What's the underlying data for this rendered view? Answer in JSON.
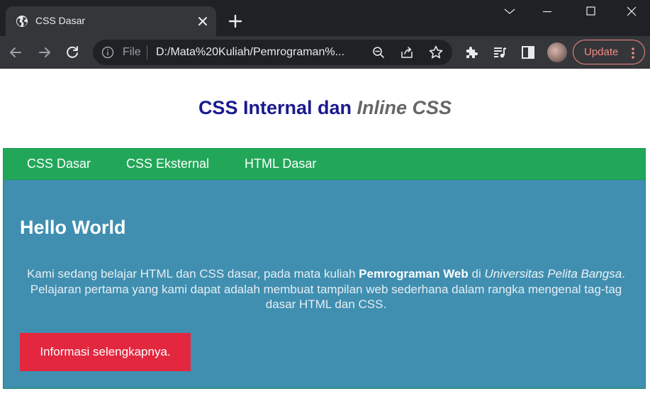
{
  "browser": {
    "tab_title": "CSS Dasar",
    "omnibox_scheme": "File",
    "url": "D:/Mata%20Kuliah/Pemrograman%...",
    "update_label": "Update",
    "colors": {
      "frame": "#202124",
      "toolbar": "#35363a",
      "update_accent": "#f28b82"
    },
    "icons": [
      "globe-icon",
      "close-icon",
      "plus-icon",
      "chevron-down-icon",
      "minimize-icon",
      "maximize-icon",
      "window-close-icon",
      "back-icon",
      "forward-icon",
      "reload-icon",
      "info-icon",
      "zoom-icon",
      "share-icon",
      "star-icon",
      "puzzle-icon",
      "media-queue-icon",
      "side-panel-icon",
      "more-vert-icon"
    ]
  },
  "page": {
    "title_part1": "CSS Internal dan",
    "title_italic": "Inline",
    "title_part2": "CSS",
    "nav": [
      "CSS Dasar",
      "CSS Eksternal",
      "HTML Dasar"
    ],
    "heading": "Hello World",
    "para": {
      "t1": "Kami sedang belajar HTML dan CSS dasar, pada mata kuliah ",
      "bold": "Pemrograman Web",
      "t2": " di ",
      "italic": "Universitas Pelita Bangsa",
      "t3": ". Pelajaran pertama yang kami dapat adalah membuat tampilan web sederhana dalam rangka mengenal tag-tag dasar HTML dan CSS."
    },
    "button_label": "Informasi selengkapnya.",
    "colors": {
      "title": "#1a1a8f",
      "nav_bg": "#22a759",
      "panel_bg": "#408fb1",
      "button_bg": "#e2273f"
    }
  }
}
